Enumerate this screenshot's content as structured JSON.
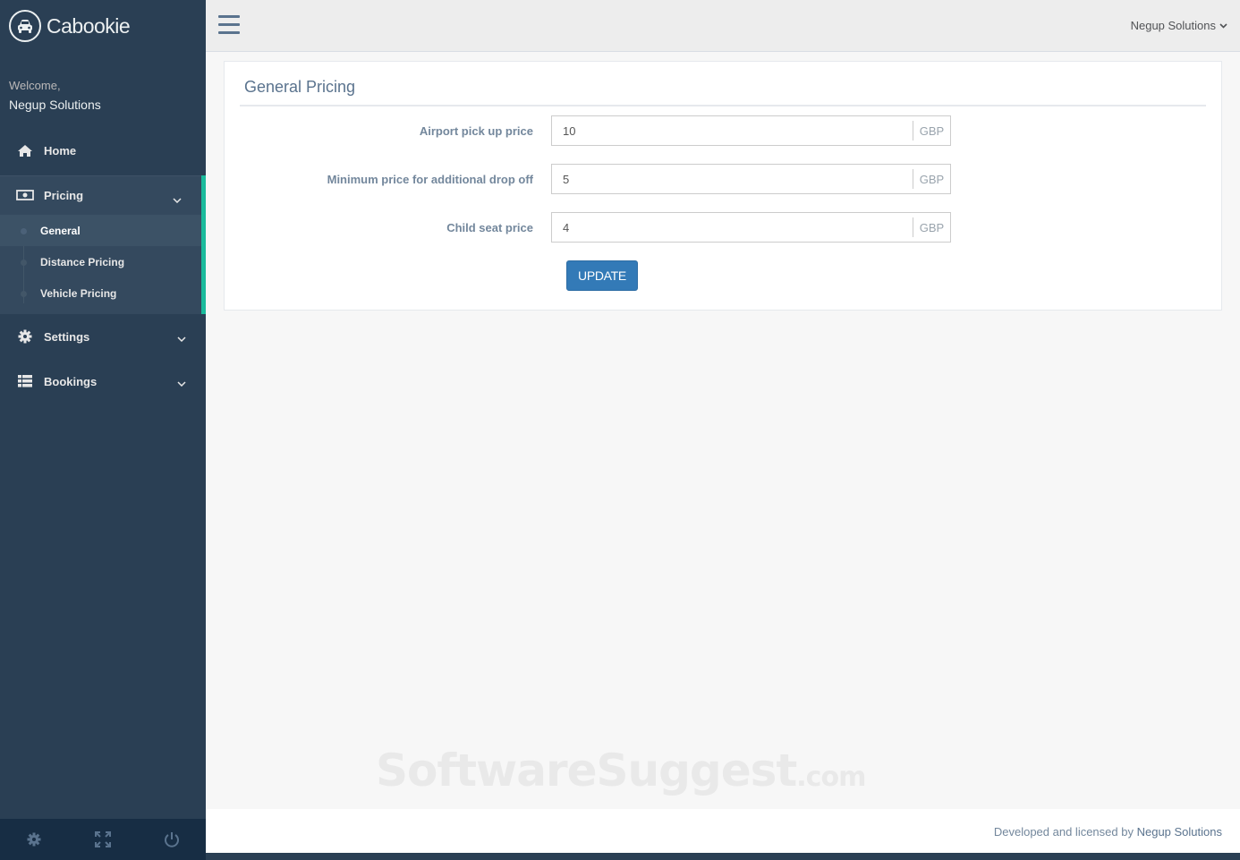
{
  "brand": {
    "name": "Cabookie",
    "icon": "taxi-icon"
  },
  "welcome": {
    "label": "Welcome,",
    "user": "Negup Solutions"
  },
  "nav": {
    "home": {
      "label": "Home",
      "icon": "home-icon"
    },
    "pricing": {
      "label": "Pricing",
      "icon": "money-icon",
      "items": [
        "General",
        "Distance Pricing",
        "Vehicle Pricing"
      ],
      "active_item": "General"
    },
    "settings": {
      "label": "Settings",
      "icon": "gear-icon"
    },
    "bookings": {
      "label": "Bookings",
      "icon": "list-icon"
    }
  },
  "sidebar_footer": [
    "settings-icon",
    "fullscreen-icon",
    "power-icon"
  ],
  "topbar": {
    "user_menu": "Negup Solutions"
  },
  "panel": {
    "title": "General Pricing",
    "fields": [
      {
        "label": "Airport pick up price",
        "value": "10",
        "unit": "GBP"
      },
      {
        "label": "Minimum price for additional drop off",
        "value": "5",
        "unit": "GBP"
      },
      {
        "label": "Child seat price",
        "value": "4",
        "unit": "GBP"
      }
    ],
    "submit_label": "UPDATE"
  },
  "watermark": {
    "main": "SoftwareSuggest",
    "suffix": ".com"
  },
  "footer": {
    "prefix": "Developed and licensed by ",
    "company": "Negup Solutions"
  },
  "colors": {
    "sidebar": "#2a3f54",
    "accent": "#1abb9c",
    "button": "#337ab7"
  }
}
